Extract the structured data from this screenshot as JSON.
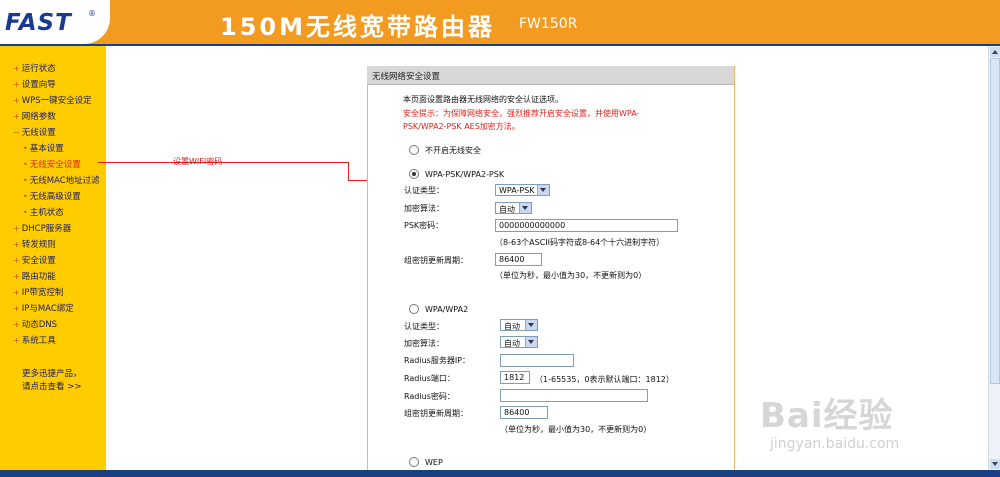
{
  "header": {
    "logo": "FAST",
    "logo_mark": "®",
    "title": "150M无线宽带路由器",
    "model": "FW150R"
  },
  "sidebar": {
    "items": [
      {
        "label": "运行状态"
      },
      {
        "label": "设置向导"
      },
      {
        "label": "WPS一键安全设定"
      },
      {
        "label": "网络参数"
      },
      {
        "label": "无线设置",
        "expanded": true
      },
      {
        "label": "基本设置",
        "sub": true
      },
      {
        "label": "无线安全设置",
        "sub": true,
        "active": true
      },
      {
        "label": "无线MAC地址过滤",
        "sub": true
      },
      {
        "label": "无线高级设置",
        "sub": true
      },
      {
        "label": "主机状态",
        "sub": true
      },
      {
        "label": "DHCP服务器"
      },
      {
        "label": "转发规则"
      },
      {
        "label": "安全设置"
      },
      {
        "label": "路由功能"
      },
      {
        "label": "IP带宽控制"
      },
      {
        "label": "IP与MAC绑定"
      },
      {
        "label": "动态DNS"
      },
      {
        "label": "系统工具"
      }
    ],
    "promo_line1": "更多迅捷产品，",
    "promo_line2": "请点击查看 >>"
  },
  "annotation": {
    "label": "设置WIFI密码"
  },
  "panel": {
    "title": "无线网络安全设置",
    "intro": "本页面设置路由器无线网络的安全认证选项。",
    "warning_line1": "安全提示：为保障网络安全，强烈推荐开启安全设置，并使用WPA-",
    "warning_line2": "PSK/WPA2-PSK AES加密方法。",
    "option_none": "不开启无线安全",
    "option_psk": "WPA-PSK/WPA2-PSK",
    "psk": {
      "auth_label": "认证类型：",
      "auth_value": "WPA-PSK",
      "enc_label": "加密算法：",
      "enc_value": "自动",
      "pwd_label": "PSK密码：",
      "pwd_value": "0000000000000",
      "pwd_hint": "（8-63个ASCII码字符或8-64个十六进制字符）",
      "renew_label": "组密钥更新周期：",
      "renew_value": "86400",
      "renew_hint": "（单位为秒，最小值为30，不更新则为0）"
    },
    "option_wpa": "WPA/WPA2",
    "wpa": {
      "auth_label": "认证类型：",
      "auth_value": "自动",
      "enc_label": "加密算法：",
      "enc_value": "自动",
      "radius_ip_label": "Radius服务器IP：",
      "radius_ip_value": "",
      "radius_port_label": "Radius端口：",
      "radius_port_value": "1812",
      "radius_port_hint": "（1-65535，0表示默认端口：1812）",
      "radius_pwd_label": "Radius密码：",
      "radius_pwd_value": "",
      "renew_label": "组密钥更新周期：",
      "renew_value": "86400",
      "renew_hint": "（单位为秒，最小值为30，不更新则为0）"
    },
    "option_wep": "WEP",
    "selected_option": "WPA-PSK/WPA2-PSK"
  },
  "watermark": {
    "brand": "Bai经验",
    "url": "jingyan.baidu.com"
  },
  "colors": {
    "header": "#f39a21",
    "sidebar": "#ffcc00",
    "navy": "#1b3f84",
    "warning": "#e0201b"
  }
}
